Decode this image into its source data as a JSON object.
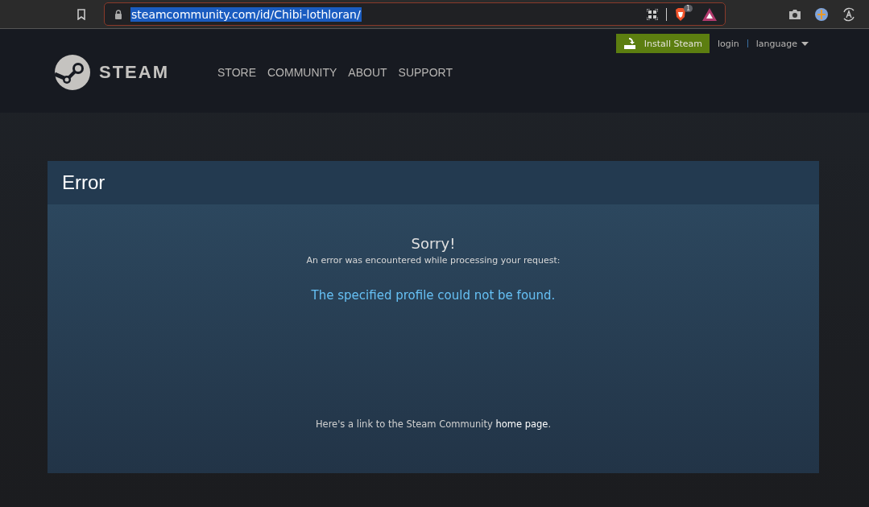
{
  "browser": {
    "url": "steamcommunity.com/id/Chibi-lothloran/",
    "url_selected": true,
    "shields_badge": "1"
  },
  "header": {
    "logo_text": "STEAM",
    "nav": [
      "STORE",
      "COMMUNITY",
      "ABOUT",
      "SUPPORT"
    ],
    "install_button": "Install Steam",
    "login": "login",
    "language": "language"
  },
  "error": {
    "title": "Error",
    "heading": "Sorry!",
    "subtitle": "An error was encountered while processing your request:",
    "message": "The specified profile could not be found.",
    "footer_before": "Here's a link to the Steam Community ",
    "footer_link": "home page",
    "footer_after": "."
  }
}
